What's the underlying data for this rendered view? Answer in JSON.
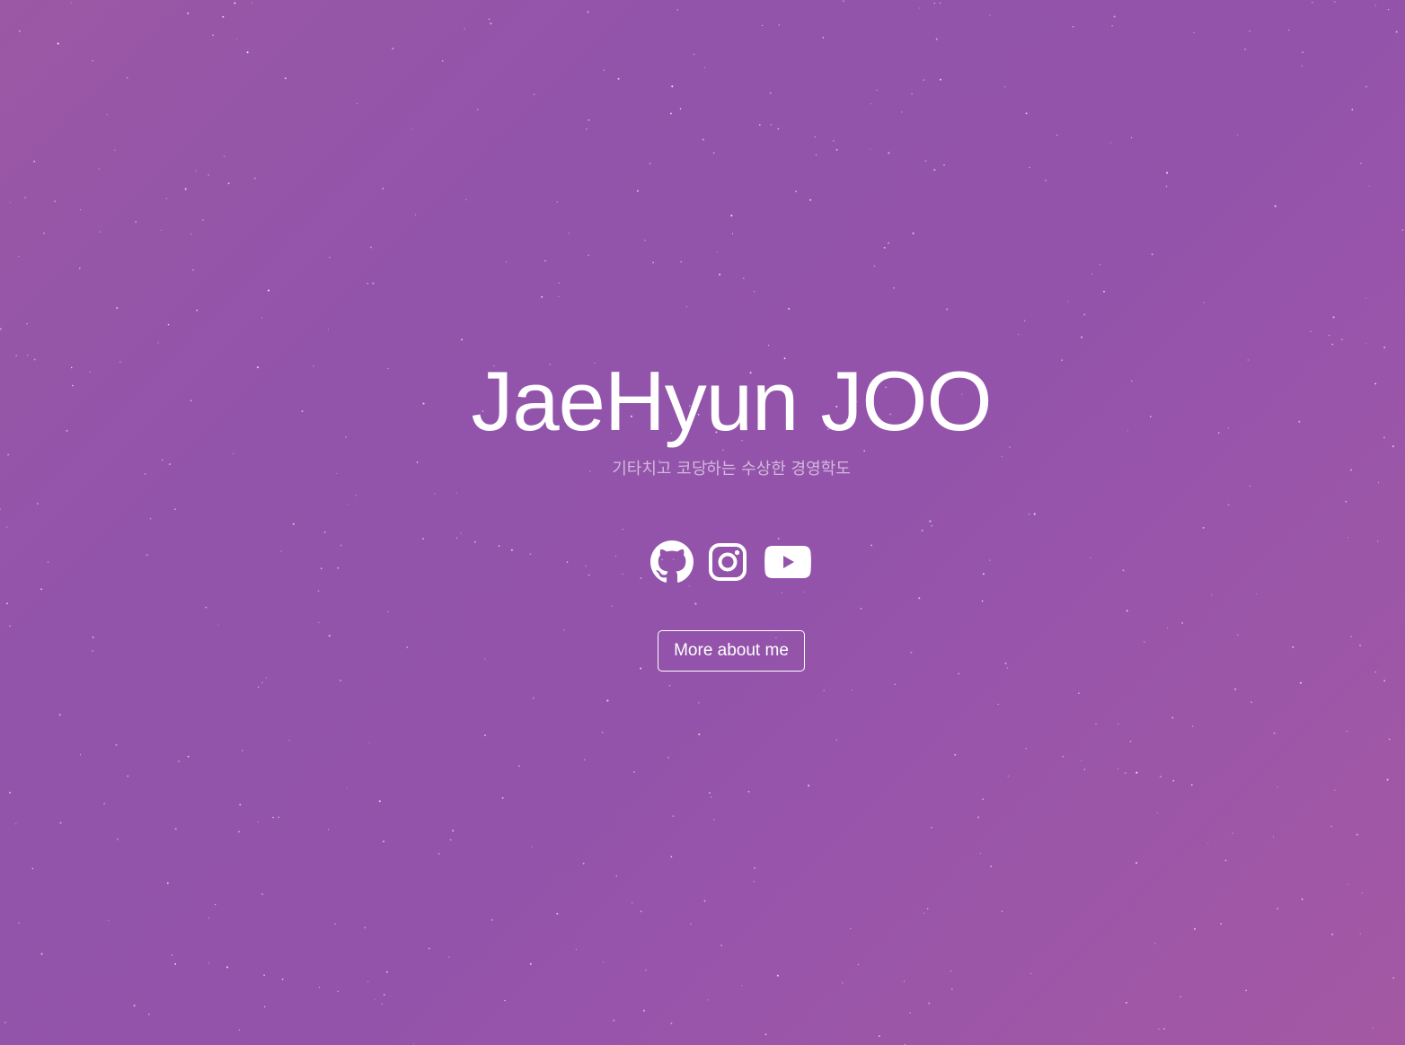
{
  "hero": {
    "title": "JaeHyun JOO",
    "subtitle": "기타치고 코딩하는 수상한 경영학도"
  },
  "social": [
    {
      "name": "GitHub",
      "icon": "github-icon"
    },
    {
      "name": "Instagram",
      "icon": "instagram-icon"
    },
    {
      "name": "YouTube",
      "icon": "youtube-icon"
    }
  ],
  "cta": {
    "label": "More about me"
  },
  "colors": {
    "background_start": "#9b58a4",
    "background_mid": "#9254ab",
    "background_end": "#a458a3",
    "text": "#ffffff",
    "subtitle": "#d3b8dc"
  }
}
